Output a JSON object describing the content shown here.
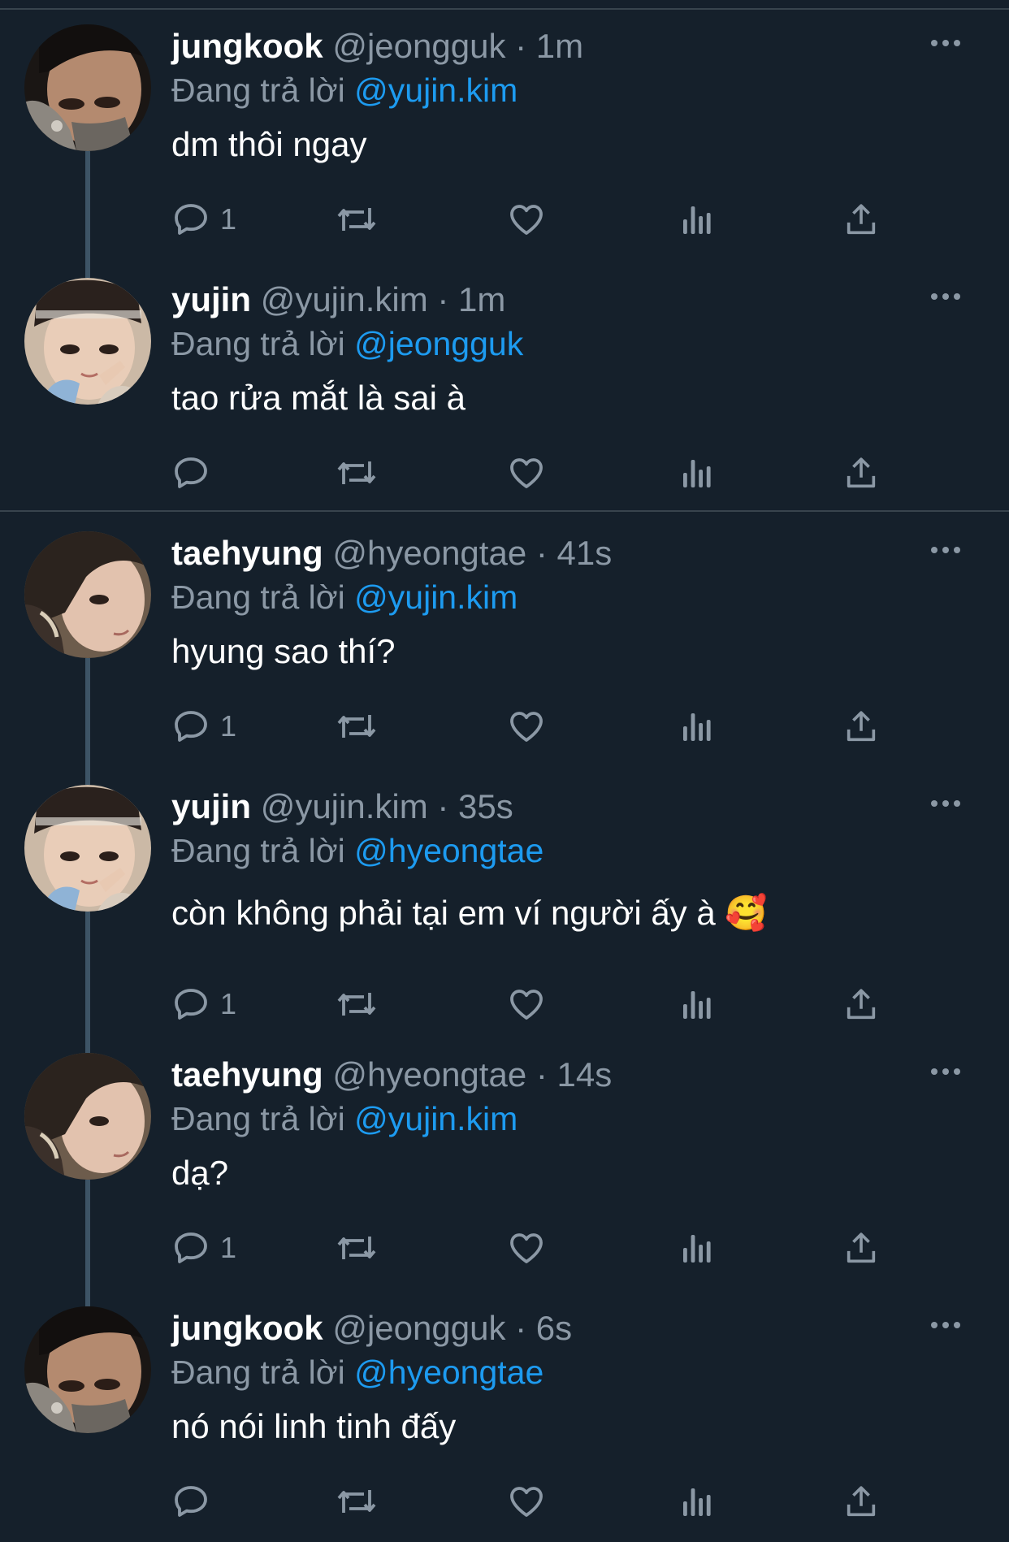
{
  "reply_prefix": "Đang trả lời",
  "tweets": [
    {
      "name": "jungkook",
      "handle": "@jeongguk",
      "time": "1m",
      "reply_to": "@yujin.kim",
      "text": "dm thôi ngay",
      "reply_count": "1"
    },
    {
      "name": "yujin",
      "handle": "@yujin.kim",
      "time": "1m",
      "reply_to": "@jeongguk",
      "text": "tao rửa mắt là sai à",
      "reply_count": ""
    },
    {
      "name": "taehyung",
      "handle": "@hyeongtae",
      "time": "41s",
      "reply_to": "@yujin.kim",
      "text": "hyung sao thí?",
      "reply_count": "1"
    },
    {
      "name": "yujin",
      "handle": "@yujin.kim",
      "time": "35s",
      "reply_to": "@hyeongtae",
      "text": "còn không phải tại em ví người ấy à 🥰",
      "reply_count": "1"
    },
    {
      "name": "taehyung",
      "handle": "@hyeongtae",
      "time": "14s",
      "reply_to": "@yujin.kim",
      "text": "dạ?",
      "reply_count": "1"
    },
    {
      "name": "jungkook",
      "handle": "@jeongguk",
      "time": "6s",
      "reply_to": "@hyeongtae",
      "text": "nó nói linh tinh đấy",
      "reply_count": ""
    }
  ],
  "icons": {
    "reply": "reply-icon",
    "retweet": "retweet-icon",
    "like": "heart-icon",
    "views": "analytics-icon",
    "share": "share-icon",
    "more": "more-icon"
  },
  "colors": {
    "background": "#15202b",
    "text": "#ffffff",
    "secondary": "#8b98a5",
    "mention": "#1d9bf0",
    "divider": "#38444d",
    "thread_line": "#3d5466"
  }
}
